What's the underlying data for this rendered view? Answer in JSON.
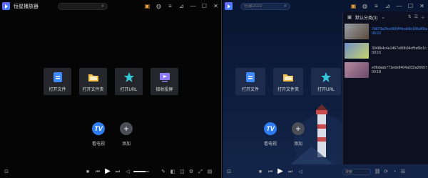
{
  "left": {
    "app_title": "恒星播放器",
    "search_placeholder": "",
    "tiles": [
      {
        "label": "打开文件",
        "icon": "file-icon"
      },
      {
        "label": "打开文件夹",
        "icon": "folder-icon"
      },
      {
        "label": "打开URL",
        "icon": "url-star-icon"
      },
      {
        "label": "接收投屏",
        "icon": "cast-icon"
      }
    ],
    "fancy": [
      {
        "label": "看电视",
        "glyph": "TV",
        "icon": "tv-icon"
      },
      {
        "label": "添加",
        "glyph": "+",
        "icon": "add-icon"
      }
    ],
    "volume_level": 0.75
  },
  "right": {
    "search_placeholder": "伤痕2022",
    "tiles": [
      {
        "label": "打开文件",
        "icon": "file-icon"
      },
      {
        "label": "打开文件夹",
        "icon": "folder-icon"
      },
      {
        "label": "打开URL",
        "icon": "url-star-icon"
      }
    ],
    "fancy": [
      {
        "label": "看电视",
        "glyph": "TV",
        "icon": "tv-icon"
      },
      {
        "label": "添加",
        "glyph": "+",
        "icon": "add-icon"
      }
    ],
    "playlist": {
      "category": "默认分类(3)",
      "items": [
        {
          "name": "7b873a2fce9664f4eab9c185af6ba050",
          "duration": "00:23",
          "active": true,
          "colors": [
            "#9aa0a8",
            "#5a4a3a"
          ]
        },
        {
          "name": "3048b4c4e1467e80b34cf5af9c1c",
          "duration": "00:15",
          "active": false,
          "colors": [
            "#6e8fc7",
            "#c9d36b"
          ]
        },
        {
          "name": "e06daab771ede8404a032a26657e7a6d",
          "duration": "00:18",
          "active": false,
          "colors": [
            "#b58aa0",
            "#6a4a6a"
          ]
        }
      ]
    },
    "bottom_search_placeholder": "搜索"
  }
}
